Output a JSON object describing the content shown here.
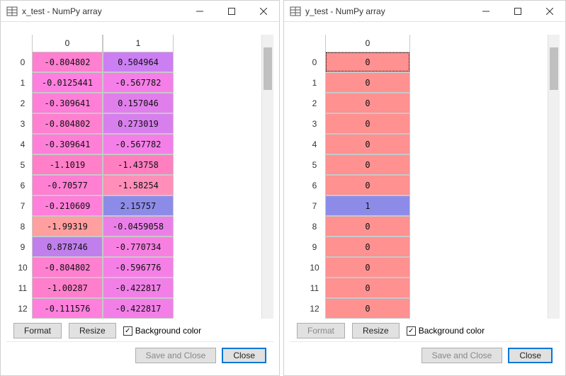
{
  "left": {
    "title": "x_test - NumPy array",
    "columns": [
      "0",
      "1"
    ],
    "rows": [
      {
        "idx": "0",
        "c": [
          "-0.804802",
          "0.504964"
        ],
        "bg": [
          "#ff7fd0",
          "#cc7ff2"
        ]
      },
      {
        "idx": "1",
        "c": [
          "-0.0125441",
          "-0.567782"
        ],
        "bg": [
          "#ff7fe0",
          "#f57fe8"
        ]
      },
      {
        "idx": "2",
        "c": [
          "-0.309641",
          "0.157046"
        ],
        "bg": [
          "#ff7fd8",
          "#e07fec"
        ]
      },
      {
        "idx": "3",
        "c": [
          "-0.804802",
          "0.273019"
        ],
        "bg": [
          "#ff7fd0",
          "#d87fee"
        ]
      },
      {
        "idx": "4",
        "c": [
          "-0.309641",
          "-0.567782"
        ],
        "bg": [
          "#ff7fd8",
          "#f57fe8"
        ]
      },
      {
        "idx": "5",
        "c": [
          "-1.1019",
          "-1.43758"
        ],
        "bg": [
          "#ff7fc8",
          "#ff7fc0"
        ]
      },
      {
        "idx": "6",
        "c": [
          "-0.70577",
          "-1.58254"
        ],
        "bg": [
          "#ff7fd2",
          "#ff8fb8"
        ]
      },
      {
        "idx": "7",
        "c": [
          "-0.210609",
          "2.15757"
        ],
        "bg": [
          "#ff7fda",
          "#8c8ce8"
        ]
      },
      {
        "idx": "8",
        "c": [
          "-1.99319",
          "-0.0459058"
        ],
        "bg": [
          "#ff9fa0",
          "#eb7fe8"
        ]
      },
      {
        "idx": "9",
        "c": [
          "0.878746",
          "-0.770734"
        ],
        "bg": [
          "#c07fec",
          "#f87fe2"
        ]
      },
      {
        "idx": "10",
        "c": [
          "-0.804802",
          "-0.596776"
        ],
        "bg": [
          "#ff7fd0",
          "#f57fe6"
        ]
      },
      {
        "idx": "11",
        "c": [
          "-1.00287",
          "-0.422817"
        ],
        "bg": [
          "#ff7fcc",
          "#f27fe8"
        ]
      },
      {
        "idx": "12",
        "c": [
          "-0.111576",
          "-0.422817"
        ],
        "bg": [
          "#ff7fdc",
          "#f27fe8"
        ]
      }
    ],
    "buttons": {
      "format": "Format",
      "resize": "Resize",
      "bgcolor": "Background color",
      "save_close": "Save and Close",
      "close": "Close"
    },
    "format_disabled": false
  },
  "right": {
    "title": "y_test - NumPy array",
    "columns": [
      "0"
    ],
    "rows": [
      {
        "idx": "0",
        "c": [
          "0"
        ],
        "bg": [
          "#ff9191"
        ],
        "sel": true
      },
      {
        "idx": "1",
        "c": [
          "0"
        ],
        "bg": [
          "#ff9191"
        ]
      },
      {
        "idx": "2",
        "c": [
          "0"
        ],
        "bg": [
          "#ff9191"
        ]
      },
      {
        "idx": "3",
        "c": [
          "0"
        ],
        "bg": [
          "#ff9191"
        ]
      },
      {
        "idx": "4",
        "c": [
          "0"
        ],
        "bg": [
          "#ff9191"
        ]
      },
      {
        "idx": "5",
        "c": [
          "0"
        ],
        "bg": [
          "#ff9191"
        ]
      },
      {
        "idx": "6",
        "c": [
          "0"
        ],
        "bg": [
          "#ff9191"
        ]
      },
      {
        "idx": "7",
        "c": [
          "1"
        ],
        "bg": [
          "#8c8ce8"
        ]
      },
      {
        "idx": "8",
        "c": [
          "0"
        ],
        "bg": [
          "#ff9191"
        ]
      },
      {
        "idx": "9",
        "c": [
          "0"
        ],
        "bg": [
          "#ff9191"
        ]
      },
      {
        "idx": "10",
        "c": [
          "0"
        ],
        "bg": [
          "#ff9191"
        ]
      },
      {
        "idx": "11",
        "c": [
          "0"
        ],
        "bg": [
          "#ff9191"
        ]
      },
      {
        "idx": "12",
        "c": [
          "0"
        ],
        "bg": [
          "#ff9191"
        ]
      }
    ],
    "buttons": {
      "format": "Format",
      "resize": "Resize",
      "bgcolor": "Background color",
      "save_close": "Save and Close",
      "close": "Close"
    },
    "format_disabled": true
  }
}
